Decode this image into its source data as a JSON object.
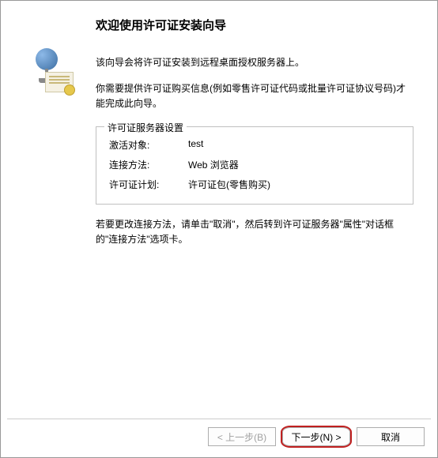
{
  "title": "欢迎使用许可证安装向导",
  "intro1": "该向导会将许可证安装到远程桌面授权服务器上。",
  "intro2": "你需要提供许可证购买信息(例如零售许可证代码或批量许可证协议号码)才能完成此向导。",
  "group": {
    "title": "许可证服务器设置",
    "rows": [
      {
        "label": "激活对象:",
        "value": "test"
      },
      {
        "label": "连接方法:",
        "value": "Web 浏览器"
      },
      {
        "label": "许可证计划:",
        "value": "许可证包(零售购买)"
      }
    ]
  },
  "note": "若要更改连接方法，请单击\"取消\"，然后转到许可证服务器\"属性\"对话框的\"连接方法\"选项卡。",
  "buttons": {
    "back": "< 上一步(B)",
    "next": "下一步(N) >",
    "cancel": "取消"
  }
}
